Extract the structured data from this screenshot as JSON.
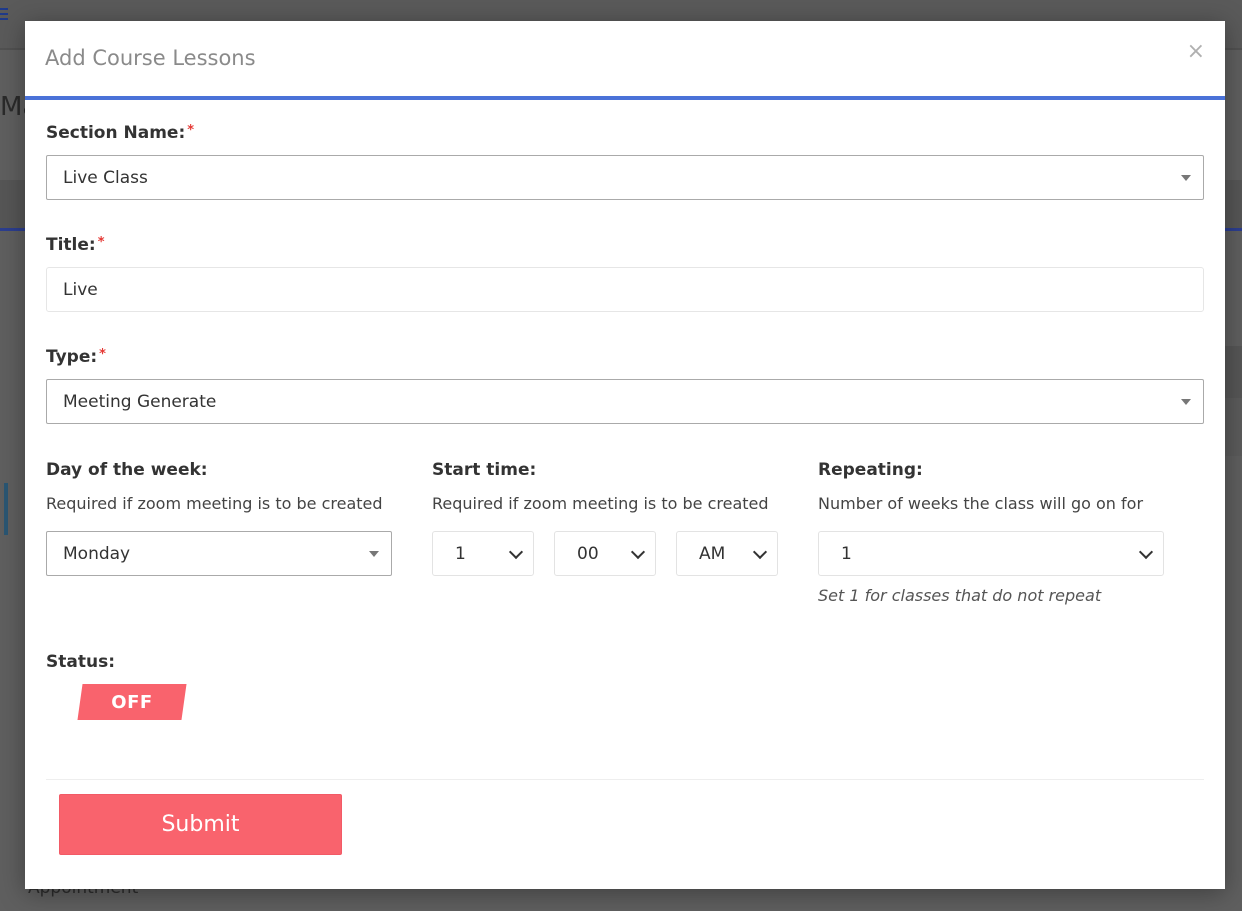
{
  "background": {
    "title_fragment": "Ma",
    "bottom_text": "Appointment"
  },
  "modal": {
    "title": "Add Course Lessons",
    "close_glyph": "×"
  },
  "form": {
    "section_name": {
      "label": "Section Name:",
      "required_mark": "*",
      "value": "Live Class"
    },
    "title": {
      "label": "Title:",
      "required_mark": "*",
      "value": "Live"
    },
    "type": {
      "label": "Type:",
      "required_mark": "*",
      "value": "Meeting Generate"
    },
    "day_of_week": {
      "label": "Day of the week:",
      "help": "Required if zoom meeting is to be created",
      "value": "Monday"
    },
    "start_time": {
      "label": "Start time:",
      "help": "Required if zoom meeting is to be created",
      "hour": "1",
      "minute": "00",
      "meridiem": "AM"
    },
    "repeating": {
      "label": "Repeating:",
      "help": "Number of weeks the class will go on for",
      "value": "1",
      "note": "Set 1 for classes that do not repeat"
    },
    "status": {
      "label": "Status:",
      "toggle_text": "OFF",
      "is_on": false
    },
    "submit_label": "Submit"
  },
  "colors": {
    "accent_blue": "#4a72d8",
    "toggle_off": "#f9636d",
    "submit": "#f9636d",
    "required": "#e53935"
  }
}
